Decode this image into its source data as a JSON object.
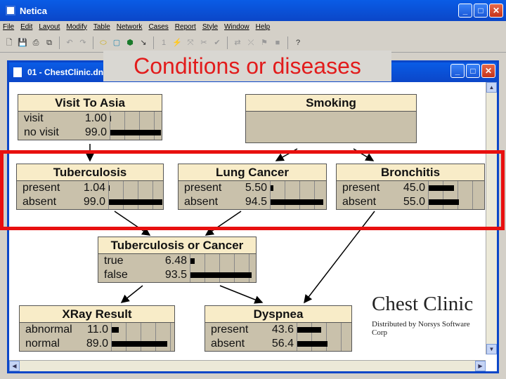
{
  "app": {
    "title": "Netica"
  },
  "window_buttons": {
    "minimize": "_",
    "maximize": "□",
    "close": "✕"
  },
  "menu": [
    "File",
    "Edit",
    "Layout",
    "Modify",
    "Table",
    "Network",
    "Cases",
    "Report",
    "Style",
    "Window",
    "Help"
  ],
  "toolbar": {
    "icons": [
      "new-icon",
      "save-icon",
      "print-icon",
      "copy-icon",
      "undo-icon",
      "redo-icon",
      "oval-node-icon",
      "rect-node-icon",
      "flag-node-icon",
      "arrow-tool-icon",
      "number-icon",
      "compile-icon",
      "absorb-icon",
      "select-icon",
      "check-icon",
      "reverse-icon",
      "link-icon",
      "finding-icon",
      "help-icon"
    ]
  },
  "document": {
    "title": "01 - ChestClinic.dne"
  },
  "nodes": [
    {
      "id": "visit",
      "title": "Visit To Asia",
      "states": [
        {
          "name": "visit",
          "value": "1.00",
          "pct": 1.0
        },
        {
          "name": "no visit",
          "value": "99.0",
          "pct": 99.0
        }
      ]
    },
    {
      "id": "smoking",
      "title": "Smoking",
      "states": []
    },
    {
      "id": "tuberculosis",
      "title": "Tuberculosis",
      "states": [
        {
          "name": "present",
          "value": "1.04",
          "pct": 1.04
        },
        {
          "name": "absent",
          "value": "99.0",
          "pct": 99.0
        }
      ]
    },
    {
      "id": "lungcancer",
      "title": "Lung Cancer",
      "states": [
        {
          "name": "present",
          "value": "5.50",
          "pct": 5.5
        },
        {
          "name": "absent",
          "value": "94.5",
          "pct": 94.5
        }
      ]
    },
    {
      "id": "bronchitis",
      "title": "Bronchitis",
      "states": [
        {
          "name": "present",
          "value": "45.0",
          "pct": 45.0
        },
        {
          "name": "absent",
          "value": "55.0",
          "pct": 55.0
        }
      ]
    },
    {
      "id": "tborcancer",
      "title": "Tuberculosis or Cancer",
      "states": [
        {
          "name": "true",
          "value": "6.48",
          "pct": 6.48
        },
        {
          "name": "false",
          "value": "93.5",
          "pct": 93.5
        }
      ]
    },
    {
      "id": "xray",
      "title": "XRay Result",
      "states": [
        {
          "name": "abnormal",
          "value": "11.0",
          "pct": 11.0
        },
        {
          "name": "normal",
          "value": "89.0",
          "pct": 89.0
        }
      ]
    },
    {
      "id": "dyspnea",
      "title": "Dyspnea",
      "states": [
        {
          "name": "present",
          "value": "43.6",
          "pct": 43.6
        },
        {
          "name": "absent",
          "value": "56.4",
          "pct": 56.4
        }
      ]
    }
  ],
  "annotation": {
    "callout": "Conditions or diseases",
    "highlight_color": "#e8100f"
  },
  "brand": {
    "name": "Chest Clinic",
    "sub": "Distributed by Norsys Software Corp"
  }
}
